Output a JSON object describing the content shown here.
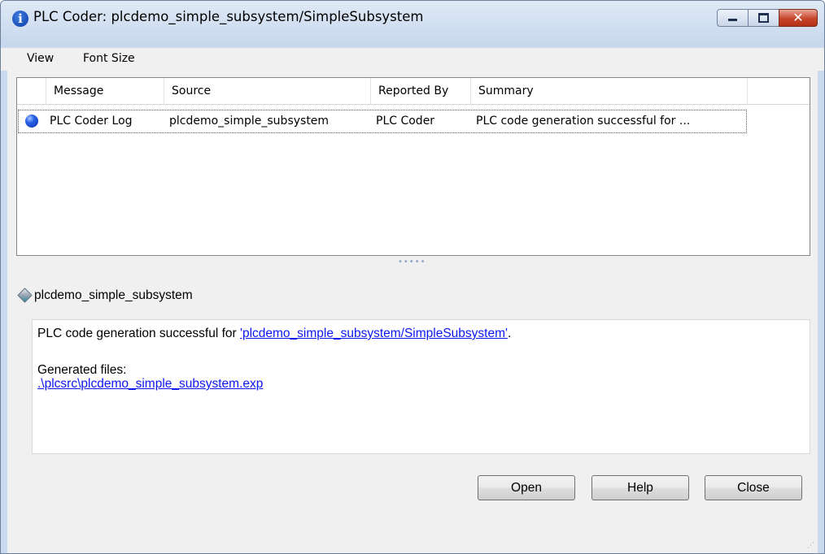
{
  "window": {
    "title": "PLC Coder: plcdemo_simple_subsystem/SimpleSubsystem",
    "title_icon": "info-icon",
    "minimize_icon": "minimize-icon",
    "maximize_icon": "maximize-icon",
    "close_glyph": "✕"
  },
  "menu": {
    "items": [
      {
        "label": "View"
      },
      {
        "label": "Font Size"
      }
    ]
  },
  "table": {
    "columns": [
      "Message",
      "Source",
      "Reported By",
      "Summary"
    ],
    "rows": [
      {
        "icon": "info-icon",
        "message": "PLC Coder Log",
        "source": "plcdemo_simple_subsystem",
        "reported_by": "PLC Coder",
        "summary": "PLC code generation successful for ..."
      }
    ]
  },
  "splitter": {
    "glyph": "•••••"
  },
  "detail": {
    "icon": "model-diamond-icon",
    "header": "plcdemo_simple_subsystem",
    "line1_prefix": "PLC code generation successful for ",
    "line1_link": "'plcdemo_simple_subsystem/SimpleSubsystem'",
    "line1_suffix": ".",
    "generated_label": "Generated files:",
    "generated_file": ".\\plcsrc\\plcdemo_simple_subsystem.exp"
  },
  "buttons": {
    "open": "Open",
    "help": "Help",
    "close": "Close"
  },
  "colors": {
    "link": "#0b16f0",
    "title_bar": "#c6d7ec",
    "close_button": "#c6452b"
  }
}
